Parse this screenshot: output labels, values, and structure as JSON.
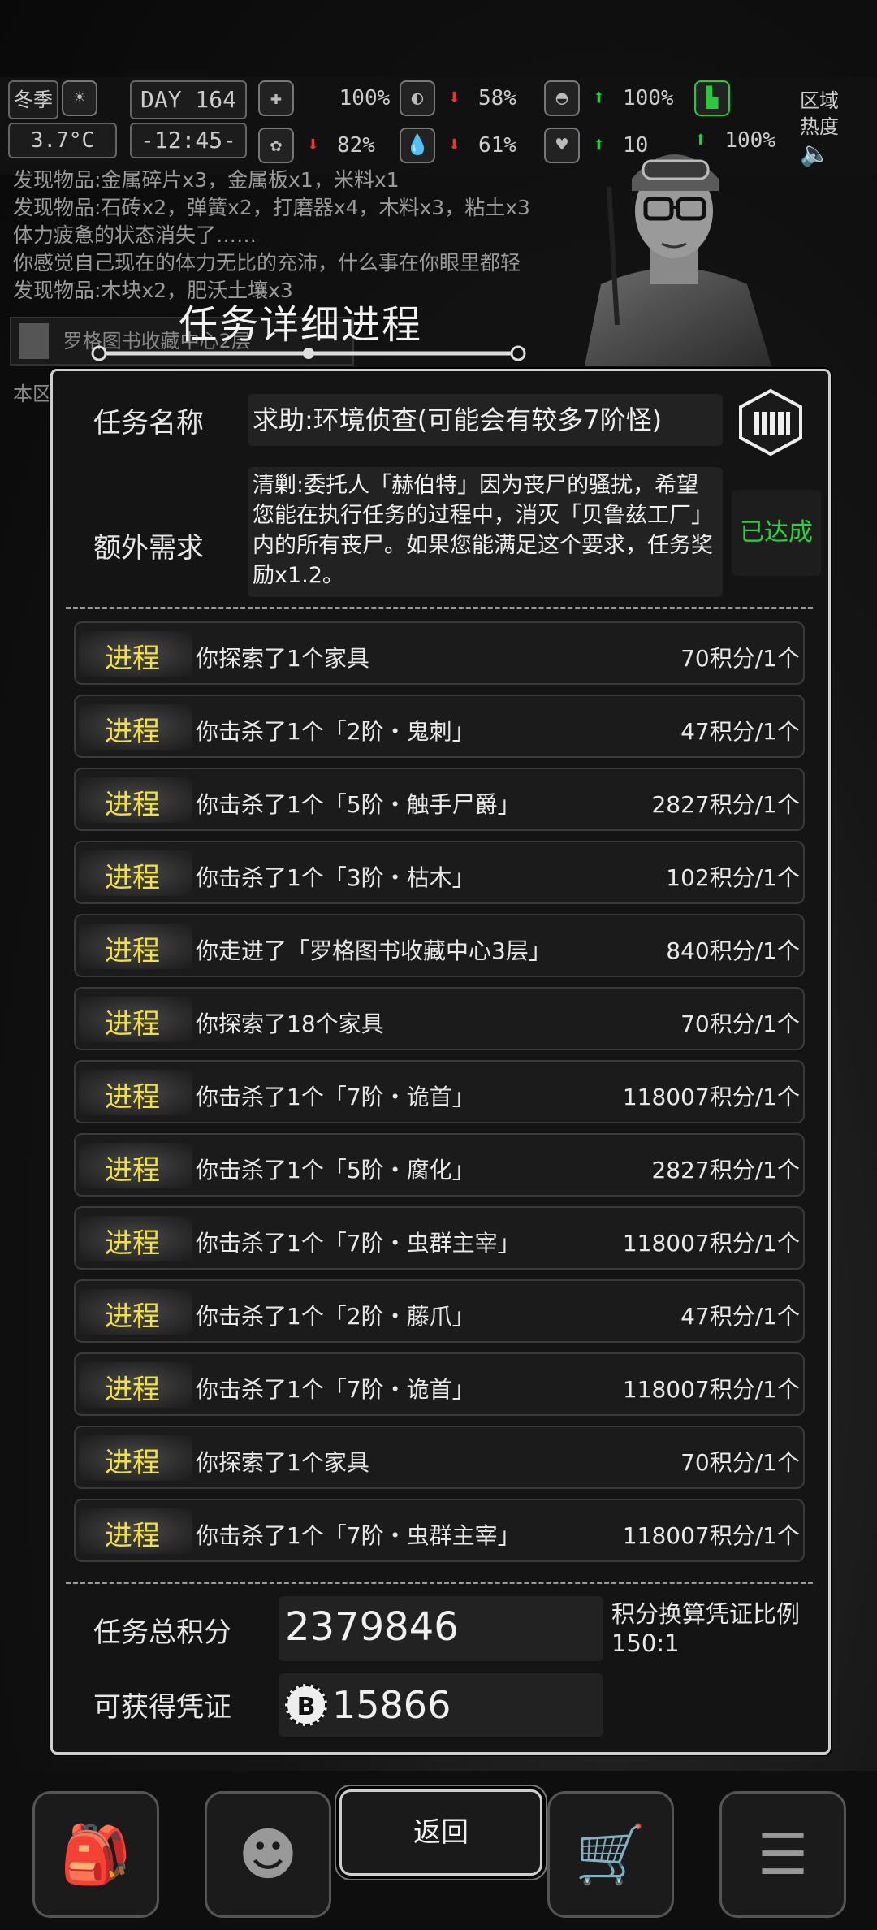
{
  "status": {
    "season": "冬季",
    "temperature": "3.7°C",
    "day_label": "DAY",
    "day": "164",
    "time": "-12:45-",
    "health": "100%",
    "hunger": "58%",
    "armor": "100%",
    "sanity": "82%",
    "thirst": "61%",
    "heart": "10",
    "stamina": "100%",
    "region_label": "区域热度"
  },
  "log": [
    "发现物品:金属碎片x3，金属板x1，米料x1",
    "发现物品:石砖x2，弹簧x2，打磨器x4，木料x3，粘土x3",
    "体力疲惫的状态消失了……",
    "你感觉自己现在的体力无比的充沛，什么事在你眼里都轻",
    "发现物品:木块x2，肥沃土壤x3"
  ],
  "location": {
    "name": "罗格图书收藏中心2层",
    "sub": "本区"
  },
  "dialog": {
    "title": "任务详细进程",
    "task_name_label": "任务名称",
    "task_name": "求助:环境侦查(可能会有较多7阶怪)",
    "extra_label": "额外需求",
    "extra_text": "清剿:委托人「赫伯特」因为丧尸的骚扰，希望您能在执行任务的过程中，消灭「贝鲁兹工厂」内的所有丧尸。如果您能满足这个要求，任务奖励x1.2。",
    "achieved": "已达成",
    "progress_tag": "进程",
    "progress": [
      {
        "desc": "你探索了1个家具",
        "points": "70积分/1个"
      },
      {
        "desc": "你击杀了1个「2阶・鬼刺」",
        "points": "47积分/1个"
      },
      {
        "desc": "你击杀了1个「5阶・触手尸爵」",
        "points": "2827积分/1个"
      },
      {
        "desc": "你击杀了1个「3阶・枯木」",
        "points": "102积分/1个"
      },
      {
        "desc": "你走进了「罗格图书收藏中心3层」",
        "points": "840积分/1个"
      },
      {
        "desc": "你探索了18个家具",
        "points": "70积分/1个"
      },
      {
        "desc": "你击杀了1个「7阶・诡首」",
        "points": "118007积分/1个"
      },
      {
        "desc": "你击杀了1个「5阶・腐化」",
        "points": "2827积分/1个"
      },
      {
        "desc": "你击杀了1个「7阶・虫群主宰」",
        "points": "118007积分/1个"
      },
      {
        "desc": "你击杀了1个「2阶・藤爪」",
        "points": "47积分/1个"
      },
      {
        "desc": "你击杀了1个「7阶・诡首」",
        "points": "118007积分/1个"
      },
      {
        "desc": "你探索了1个家具",
        "points": "70积分/1个"
      },
      {
        "desc": "你击杀了1个「7阶・虫群主宰」",
        "points": "118007积分/1个"
      }
    ],
    "total_label": "任务总积分",
    "total_value": "2379846",
    "ratio_label": "积分换算凭证比例",
    "ratio_value": "150:1",
    "voucher_label": "可获得凭证",
    "voucher_value": "15866",
    "back_label": "返回"
  }
}
